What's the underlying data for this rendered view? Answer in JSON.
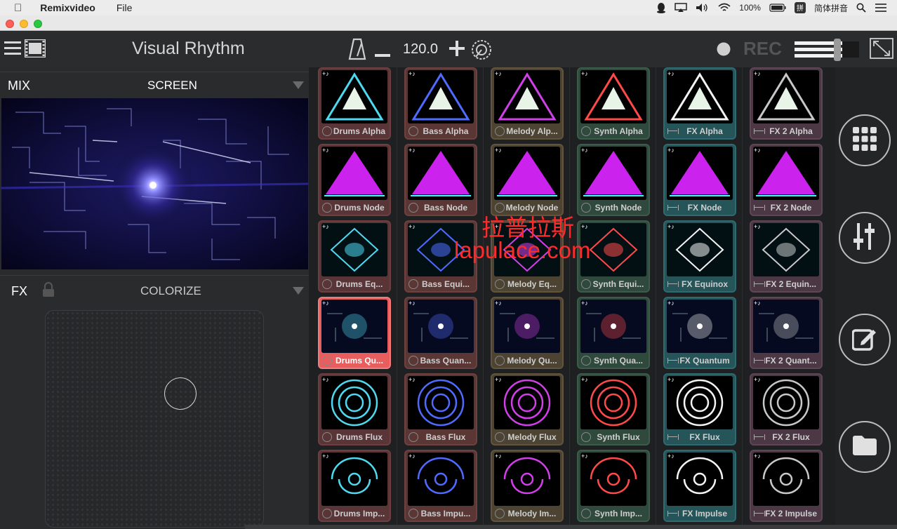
{
  "menubar": {
    "app_name": "Remixvideo",
    "file_menu": "File",
    "battery": "100%",
    "input_method": "简体拼音"
  },
  "toolbar": {
    "title": "Visual Rhythm",
    "bpm": "120.0",
    "rec_label": "REC"
  },
  "mix": {
    "label": "MIX",
    "output": "SCREEN"
  },
  "fx": {
    "label": "FX",
    "effect": "COLORIZE"
  },
  "watermark": {
    "cn": "拉普拉斯",
    "url": "lapulace.com"
  },
  "columns": [
    {
      "group": "drums",
      "label_icon": "circle",
      "cells": [
        "Drums Alpha",
        "Drums Node",
        "Drums Eq...",
        "Drums Qu...",
        "Drums Flux",
        "Drums Imp..."
      ]
    },
    {
      "group": "bass",
      "label_icon": "circle",
      "cells": [
        "Bass Alpha",
        "Bass Node",
        "Bass Equi...",
        "Bass Quan...",
        "Bass Flux",
        "Bass Impu..."
      ]
    },
    {
      "group": "melody",
      "label_icon": "circle",
      "cells": [
        "Melody Alp...",
        "Melody Node",
        "Melody Eq...",
        "Melody Qu...",
        "Melody Flux",
        "Melody Im..."
      ]
    },
    {
      "group": "synth",
      "label_icon": "circle",
      "cells": [
        "Synth Alpha",
        "Synth Node",
        "Synth Equi...",
        "Synth Qua...",
        "Synth Flux",
        "Synth Imp..."
      ]
    },
    {
      "group": "fx",
      "label_icon": "line",
      "cells": [
        "FX Alpha",
        "FX Node",
        "FX Equinox",
        "FX Quantum",
        "FX Flux",
        "FX Impulse"
      ]
    },
    {
      "group": "fx2",
      "label_icon": "line",
      "cells": [
        "FX 2 Alpha",
        "FX 2 Node",
        "FX 2 Equin...",
        "FX 2 Quant...",
        "FX 2 Flux",
        "FX 2 Impulse"
      ]
    }
  ],
  "selected_cell": "Drums Qu...",
  "colors": {
    "accent_selected": "#e85d5d",
    "background": "#1e1f21"
  }
}
